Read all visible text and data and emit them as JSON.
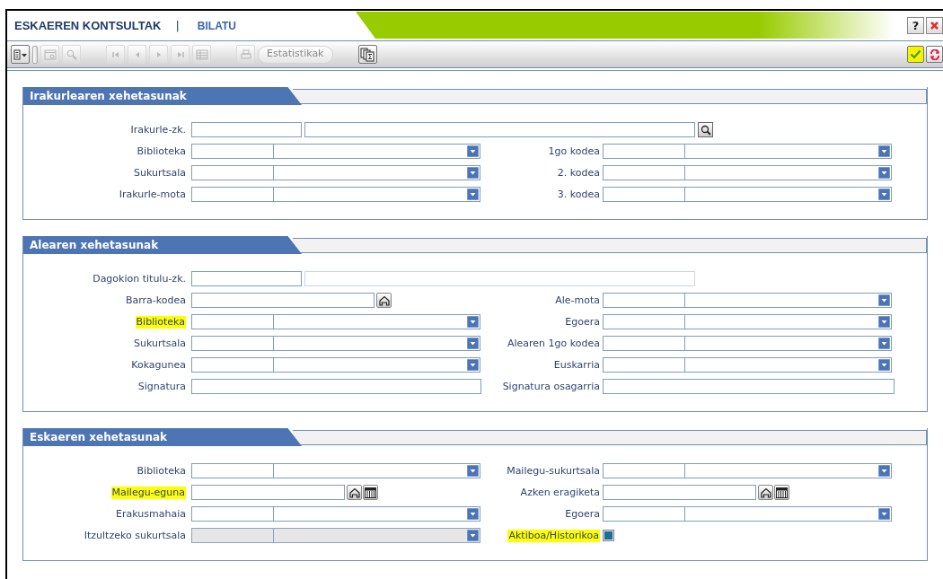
{
  "window": {
    "title": "ESKAEREN KONTSULTAK",
    "separator": "|",
    "subtitle": "BILATU",
    "help": "?"
  },
  "toolbar": {
    "groups": [
      [
        {
          "kind": "menu",
          "disabled": false
        },
        {
          "kind": "handle",
          "disabled": false
        },
        {
          "kind": "preview",
          "disabled": true
        },
        {
          "kind": "search",
          "disabled": true
        }
      ],
      [
        {
          "kind": "first",
          "disabled": true
        },
        {
          "kind": "prev",
          "disabled": true
        },
        {
          "kind": "next",
          "disabled": true
        },
        {
          "kind": "last",
          "disabled": true
        },
        {
          "kind": "grid",
          "disabled": true
        }
      ],
      [
        {
          "kind": "print",
          "disabled": true
        },
        {
          "kind": "text",
          "label": "Estatistikak",
          "disabled": true
        }
      ],
      [
        {
          "kind": "stats",
          "disabled": false
        }
      ]
    ],
    "right": [
      {
        "kind": "accept",
        "highlighted": true
      },
      {
        "kind": "cancel",
        "highlighted": false
      }
    ]
  },
  "sections": [
    {
      "title": "Irakurlearen xehetasunak",
      "rows": [
        {
          "left": {
            "label": "Irakurle-zk.",
            "kind": "lookup",
            "highlighted": false,
            "disabled": false
          }
        },
        {
          "left": {
            "label": "Biblioteka",
            "kind": "select",
            "highlighted": false,
            "disabled": false
          },
          "right": {
            "label": "1go kodea",
            "kind": "select",
            "highlighted": false,
            "disabled": false
          }
        },
        {
          "left": {
            "label": "Sukurtsala",
            "kind": "select",
            "highlighted": false,
            "disabled": false
          },
          "right": {
            "label": "2. kodea",
            "kind": "select",
            "highlighted": false,
            "disabled": false
          }
        },
        {
          "left": {
            "label": "Irakurle-mota",
            "kind": "select",
            "highlighted": false,
            "disabled": false
          },
          "right": {
            "label": "3. kodea",
            "kind": "select",
            "highlighted": false,
            "disabled": false
          }
        }
      ]
    },
    {
      "title": "Alearen xehetasunak",
      "rows": [
        {
          "left": {
            "label": "Dagokion titulu-zk.",
            "kind": "pair",
            "highlighted": false,
            "disabled": false
          }
        },
        {
          "left": {
            "label": "Barra-kodea",
            "kind": "barcode",
            "highlighted": false,
            "disabled": false
          },
          "right": {
            "label": "Ale-mota",
            "kind": "select",
            "highlighted": false,
            "disabled": false
          }
        },
        {
          "left": {
            "label": "Biblioteka",
            "kind": "select",
            "highlighted": true,
            "disabled": false
          },
          "right": {
            "label": "Egoera",
            "kind": "select",
            "highlighted": false,
            "disabled": false
          }
        },
        {
          "left": {
            "label": "Sukurtsala",
            "kind": "select",
            "highlighted": false,
            "disabled": false
          },
          "right": {
            "label": "Alearen 1go kodea",
            "kind": "select",
            "highlighted": false,
            "disabled": false
          }
        },
        {
          "left": {
            "label": "Kokagunea",
            "kind": "select",
            "highlighted": false,
            "disabled": false
          },
          "right": {
            "label": "Euskarria",
            "kind": "select",
            "highlighted": false,
            "disabled": false
          }
        },
        {
          "left": {
            "label": "Signatura",
            "kind": "text",
            "highlighted": false,
            "disabled": false
          },
          "right": {
            "label": "Signatura osagarria",
            "kind": "text",
            "highlighted": false,
            "disabled": false
          }
        }
      ]
    },
    {
      "title": "Eskaeren xehetasunak",
      "rows": [
        {
          "left": {
            "label": "Biblioteka",
            "kind": "select",
            "highlighted": false,
            "disabled": false
          },
          "right": {
            "label": "Mailegu-sukurtsala",
            "kind": "select",
            "highlighted": false,
            "disabled": false
          }
        },
        {
          "left": {
            "label": "Mailegu-eguna",
            "kind": "date",
            "highlighted": true,
            "disabled": false
          },
          "right": {
            "label": "Azken eragiketa",
            "kind": "date",
            "highlighted": false,
            "disabled": false
          }
        },
        {
          "left": {
            "label": "Erakusmahaia",
            "kind": "select",
            "highlighted": false,
            "disabled": false
          },
          "right": {
            "label": "Egoera",
            "kind": "select",
            "highlighted": false,
            "disabled": false
          }
        },
        {
          "left": {
            "label": "Itzultzeko sukurtsala",
            "kind": "select",
            "highlighted": false,
            "disabled": true
          },
          "right": {
            "label": "Aktiboa/Historikoa",
            "kind": "checkbox",
            "highlighted": true,
            "disabled": false,
            "checked": false
          }
        }
      ]
    }
  ]
}
